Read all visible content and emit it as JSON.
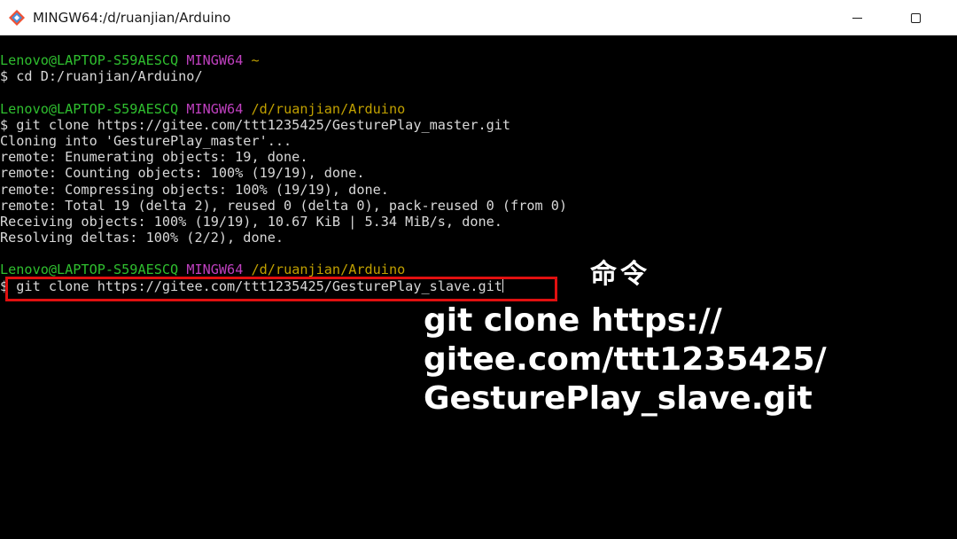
{
  "window": {
    "title": "MINGW64:/d/ruanjian/Arduino",
    "icon": "git-bash-icon",
    "controls": [
      "minimize",
      "maximize"
    ]
  },
  "terminal": {
    "lines": [
      {
        "type": "prompt",
        "user": "Lenovo@LAPTOP-S59AESCQ",
        "shell": "MINGW64",
        "path": "~"
      },
      {
        "type": "text",
        "text": "$ cd D:/ruanjian/Arduino/"
      },
      {
        "type": "blank",
        "text": ""
      },
      {
        "type": "prompt",
        "user": "Lenovo@LAPTOP-S59AESCQ",
        "shell": "MINGW64",
        "path": "/d/ruanjian/Arduino"
      },
      {
        "type": "text",
        "text": "$ git clone https://gitee.com/ttt1235425/GesturePlay_master.git"
      },
      {
        "type": "text",
        "text": "Cloning into 'GesturePlay_master'..."
      },
      {
        "type": "text",
        "text": "remote: Enumerating objects: 19, done."
      },
      {
        "type": "text",
        "text": "remote: Counting objects: 100% (19/19), done."
      },
      {
        "type": "text",
        "text": "remote: Compressing objects: 100% (19/19), done."
      },
      {
        "type": "text",
        "text": "remote: Total 19 (delta 2), reused 0 (delta 0), pack-reused 0 (from 0)"
      },
      {
        "type": "text",
        "text": "Receiving objects: 100% (19/19), 10.67 KiB | 5.34 MiB/s, done."
      },
      {
        "type": "text",
        "text": "Resolving deltas: 100% (2/2), done."
      },
      {
        "type": "blank",
        "text": ""
      },
      {
        "type": "prompt",
        "user": "Lenovo@LAPTOP-S59AESCQ",
        "shell": "MINGW64",
        "path": "/d/ruanjian/Arduino"
      }
    ],
    "current_input": "$ git clone https://gitee.com/ttt1235425/GesturePlay_slave.git"
  },
  "annotation": {
    "heading": "命令",
    "command_lines": [
      "git clone https://",
      "gitee.com/ttt1235425/",
      "GesturePlay_slave.git"
    ],
    "highlight_color": "#e01010"
  },
  "colors": {
    "background": "#000000",
    "user": "#2fbf2f",
    "shell": "#bf40bf",
    "path": "#c0a000",
    "text": "#d8d8d8"
  }
}
